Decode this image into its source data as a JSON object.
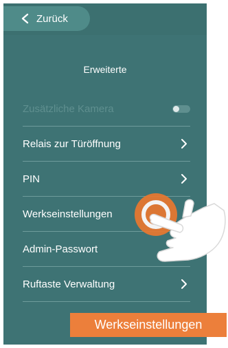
{
  "nav": {
    "back_label": "Zurück"
  },
  "screen": {
    "title": "Erweiterte"
  },
  "settings": [
    {
      "label": "Zusätzliche Kamera",
      "control": "toggle",
      "enabled": false
    },
    {
      "label": "Relais zur Türöffnung",
      "control": "chevron"
    },
    {
      "label": "PIN",
      "control": "chevron"
    },
    {
      "label": "Werkseinstellungen",
      "control": "none"
    },
    {
      "label": "Admin-Passwort",
      "control": "none"
    },
    {
      "label": "Ruftaste Verwaltung",
      "control": "chevron"
    }
  ],
  "caption": "Werkseinstellungen",
  "colors": {
    "background": "#3e7374",
    "accent": "#ec7f3b",
    "highlight_ring": "#e9772f"
  },
  "icons": {
    "back": "chevron-left-icon",
    "row": "chevron-right-icon",
    "gesture": "tap-hand-icon"
  }
}
